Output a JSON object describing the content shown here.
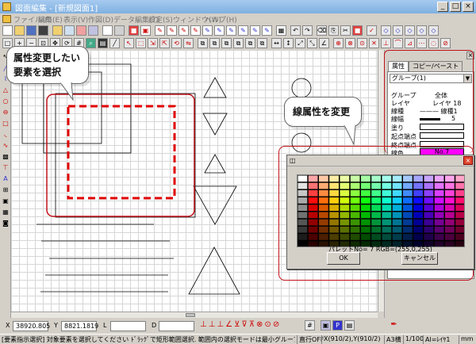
{
  "window": {
    "title": "図面編集 - [新規図面1]",
    "controls": [
      "_",
      "□",
      "×"
    ]
  },
  "menu": [
    {
      "label": "ファイル(F)"
    },
    {
      "label": "編集(E)"
    },
    {
      "label": "表示(V)"
    },
    {
      "label": "作図(D)"
    },
    {
      "label": "データ編集(T)"
    },
    {
      "label": "設定(S)"
    },
    {
      "label": "ウィンドウ(W)"
    },
    {
      "label": "ヘルプ(H)"
    }
  ],
  "callouts": {
    "left": {
      "line1": "属性変更したい",
      "line2": "要素を選択"
    },
    "right": {
      "text": "線属性を変更"
    }
  },
  "panel": {
    "tabs": [
      "属性",
      "コピー/ペースト"
    ],
    "group_select": "グループ(1)",
    "properties": [
      {
        "label": "グループ",
        "value": "全体"
      },
      {
        "label": "レイヤ",
        "value": "レイヤ 18"
      },
      {
        "label": "線種",
        "value": "——— 線種1"
      },
      {
        "label": "線幅",
        "value": "5"
      },
      {
        "label": "塗り",
        "value": ""
      },
      {
        "label": "起点端点",
        "value": ""
      },
      {
        "label": "終点端点",
        "value": ""
      },
      {
        "label": "線色",
        "value": "No.7"
      }
    ],
    "line_color": "#ff00ff"
  },
  "dialog": {
    "title_icon": "palette-icon",
    "info": "パレットNo= 7   RGB=(255,0,255)",
    "ok_label": "OK",
    "cancel_label": "キャンセル"
  },
  "coords": {
    "x_label": "X",
    "x_value": "38920.805",
    "y_label": "Y",
    "y_value": "8821.1819",
    "l_label": "L",
    "l_value": "",
    "d_label": "D",
    "d_value": ""
  },
  "status": {
    "message": "[要素指示選択] 対象要素を選択してください ﾄﾞﾗｯｸﾞで矩形範囲選択. 範囲内の選択モードは最小グループ要素です。",
    "snap": "直行OFF",
    "xy": "X(910/2),Y(910/2)",
    "paper": "A3横",
    "scale": "1/100",
    "layer": "Al=ﾚｲﾔ1",
    "unit": "mm"
  }
}
